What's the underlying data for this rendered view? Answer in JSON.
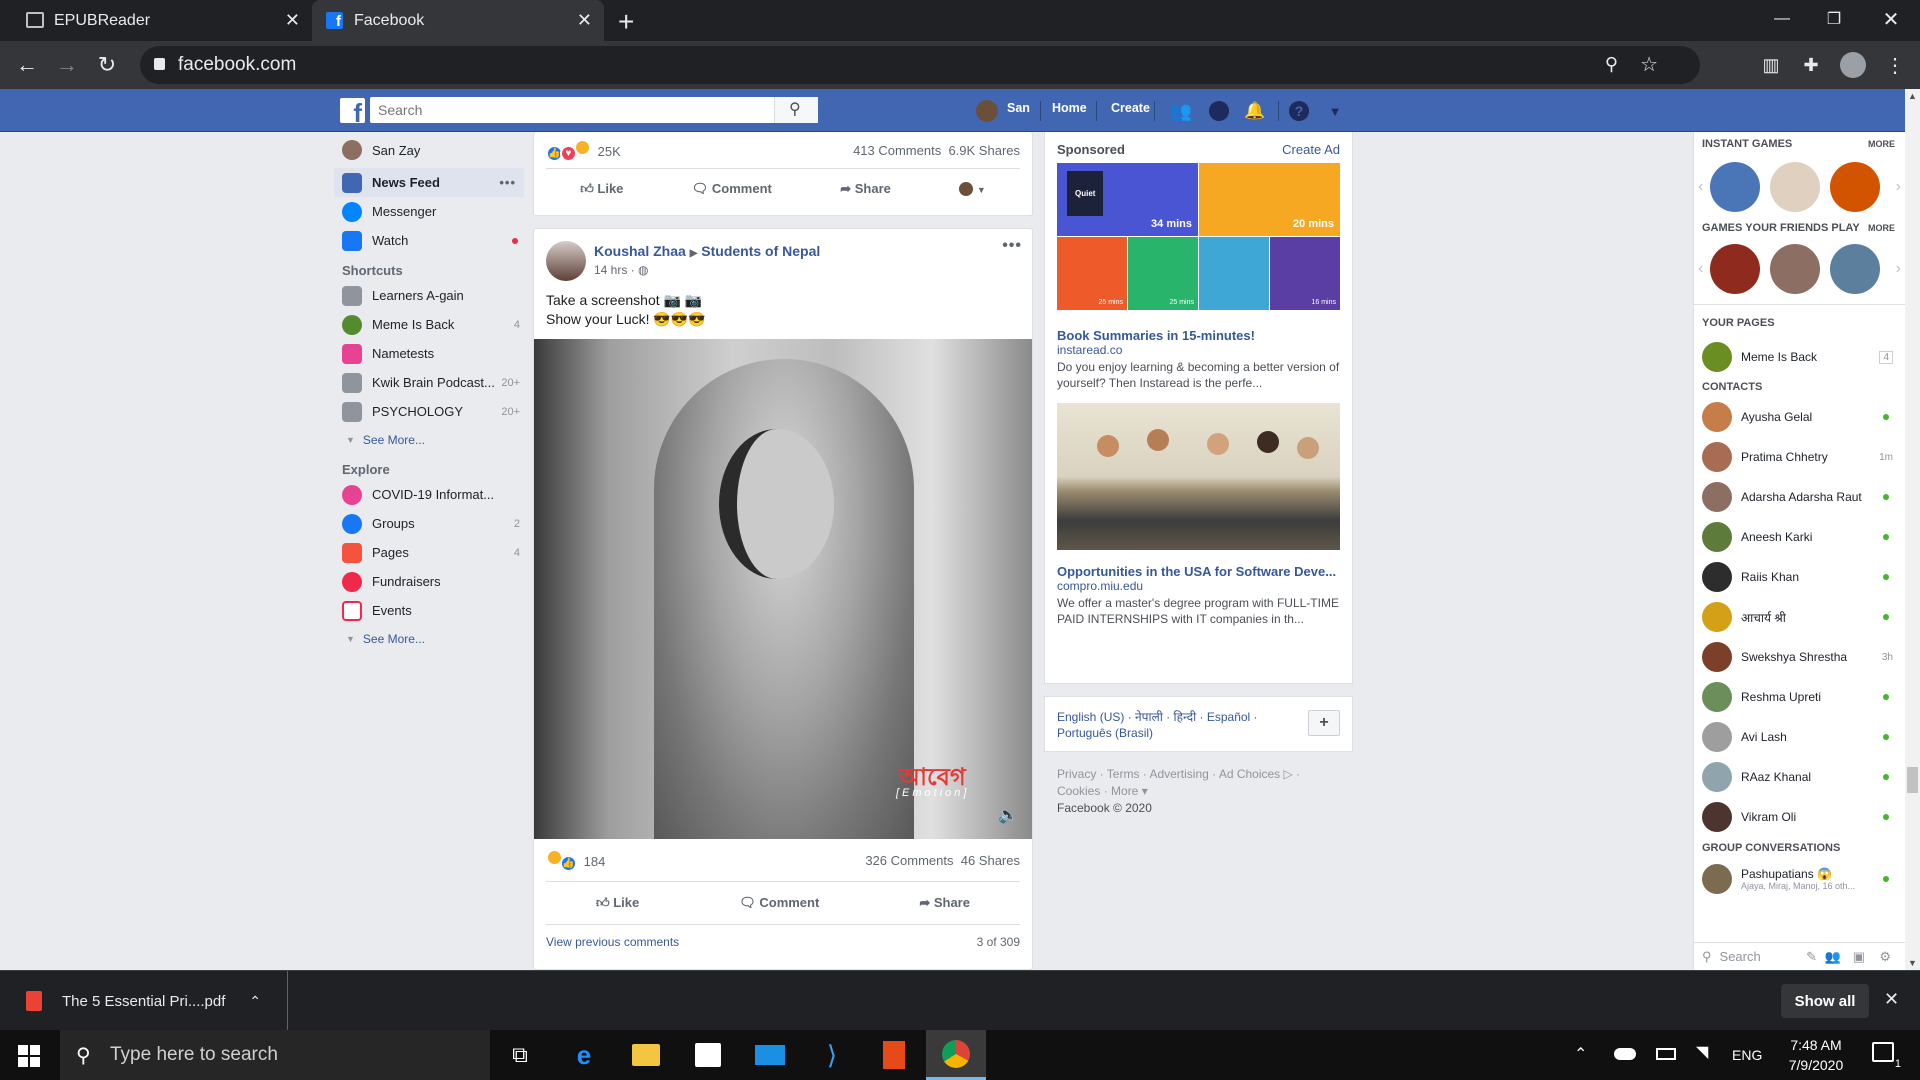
{
  "browser": {
    "tabs": [
      {
        "label": "EPUBReader"
      },
      {
        "label": "Facebook"
      }
    ],
    "url": "facebook.com"
  },
  "fb_header": {
    "search_placeholder": "Search",
    "user": "San",
    "home": "Home",
    "create": "Create"
  },
  "left": {
    "profile": "San Zay",
    "main": [
      {
        "label": "News Feed"
      },
      {
        "label": "Messenger"
      },
      {
        "label": "Watch"
      }
    ],
    "shortcuts_title": "Shortcuts",
    "shortcuts": [
      {
        "label": "Learners A-gain",
        "count": ""
      },
      {
        "label": "Meme Is Back",
        "count": "4"
      },
      {
        "label": "Nametests",
        "count": ""
      },
      {
        "label": "Kwik Brain Podcast...",
        "count": "20+"
      },
      {
        "label": "PSYCHOLOGY",
        "count": "20+"
      }
    ],
    "see_more": "See More...",
    "explore_title": "Explore",
    "explore": [
      {
        "label": "COVID-19 Informat...",
        "count": ""
      },
      {
        "label": "Groups",
        "count": "2"
      },
      {
        "label": "Pages",
        "count": "4"
      },
      {
        "label": "Fundraisers",
        "count": ""
      },
      {
        "label": "Events",
        "count": ""
      }
    ]
  },
  "post1": {
    "reactions": "25K",
    "comments": "413 Comments",
    "shares": "6.9K Shares"
  },
  "actions": {
    "like": "Like",
    "comment": "Comment",
    "share": "Share"
  },
  "post2": {
    "author": "Koushal Zhaa",
    "group": "Students of Nepal",
    "time": "14 hrs · ",
    "line1": "Take a screenshot 📷 📷",
    "line2": "Show your Luck! 😎😎😎",
    "watermark": "আবেগ",
    "watermark_sub": "[Emotion]",
    "reactions": "184",
    "comments": "326 Comments",
    "shares": "46 Shares",
    "view_prev": "View previous comments",
    "count": "3 of 309"
  },
  "ads": {
    "sponsored": "Sponsored",
    "create_ad": "Create Ad",
    "ad1": {
      "title": "Book Summaries in 15-minutes!",
      "domain": "instaread.co",
      "desc": "Do you enjoy learning & becoming a better version of yourself? Then Instaread is the perfe...",
      "tiles": [
        "34 mins",
        "20 mins",
        "25 mins",
        "25 mins",
        "16 mins"
      ],
      "book": "Quiet"
    },
    "ad2": {
      "title": "Opportunities in the USA for Software Deve...",
      "domain": "compro.miu.edu",
      "desc": "We offer a master's degree program with FULL-TIME PAID INTERNSHIPS with IT companies in th..."
    }
  },
  "lang": {
    "line": "English (US) · नेपाली · हिन्दी · Español · ",
    "line2": "Português (Brasil)"
  },
  "footer": {
    "line1": "Privacy · Terms · Advertising · Ad Choices ▷ ·",
    "line2": "Cookies · More ▾",
    "line3": "Facebook © 2020"
  },
  "sidebar": {
    "instant_games": "INSTANT GAMES",
    "more": "MORE",
    "friends_play": "GAMES YOUR FRIENDS PLAY",
    "your_pages": "YOUR PAGES",
    "page": {
      "name": "Meme Is Back",
      "count": "4"
    },
    "contacts_title": "CONTACTS",
    "contacts": [
      {
        "name": "Ayusha Gelal",
        "time": ""
      },
      {
        "name": "Pratima Chhetry",
        "time": "1m"
      },
      {
        "name": "Adarsha Adarsha Raut",
        "time": ""
      },
      {
        "name": "Aneesh Karki",
        "time": ""
      },
      {
        "name": "Raiis Khan",
        "time": ""
      },
      {
        "name": "आचार्य श्री",
        "time": ""
      },
      {
        "name": "Swekshya Shrestha",
        "time": "3h"
      },
      {
        "name": "Reshma Upreti",
        "time": ""
      },
      {
        "name": "Avi Lash",
        "time": ""
      },
      {
        "name": "RAaz Khanal",
        "time": ""
      },
      {
        "name": "Vikram Oli",
        "time": ""
      }
    ],
    "group_title": "GROUP CONVERSATIONS",
    "group": {
      "name": "Pashupatians 😱",
      "members": "Ajaya, Miraj, Manoj, 16 oth..."
    },
    "search": "Search"
  },
  "download": {
    "file": "The 5 Essential Pri....pdf",
    "show_all": "Show all"
  },
  "taskbar": {
    "search": "Type here to search",
    "time": "7:48 AM",
    "date": "7/9/2020",
    "lang": "ENG",
    "notif": "1"
  }
}
